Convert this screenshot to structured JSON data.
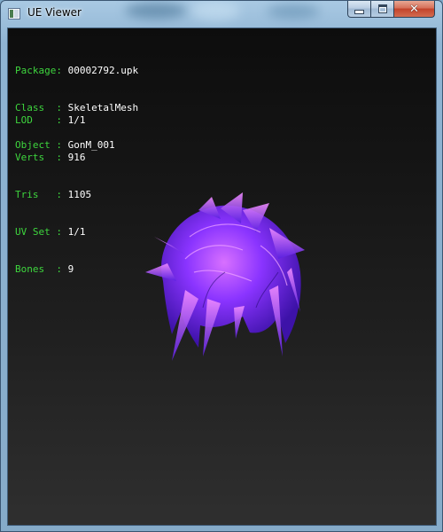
{
  "window": {
    "title": "UE Viewer",
    "controls": {
      "minimize": "minimize",
      "maximize": "maximize",
      "close": "✕"
    }
  },
  "info": {
    "package_label": "Package",
    "package_value": "00002792.upk",
    "class_label": "Class  ",
    "class_value": "SkeletalMesh",
    "object_label": "Object ",
    "object_value": "GonM_001"
  },
  "stats": {
    "lod_label": "LOD    ",
    "lod_value": "1/1",
    "verts_label": "Verts  ",
    "verts_value": "916",
    "tris_label": "Tris   ",
    "tris_value": "1105",
    "uvset_label": "UV Set ",
    "uvset_value": "1/1",
    "bones_label": "Bones  ",
    "bones_value": "9"
  },
  "colors": {
    "label_green": "#3ed63e",
    "value_white": "#ffffff",
    "hair_primary": "#7a2cff",
    "hair_highlight": "#e56bff",
    "hair_shadow": "#3a0f9a"
  },
  "model": {
    "icon": "hair-mesh-render"
  }
}
